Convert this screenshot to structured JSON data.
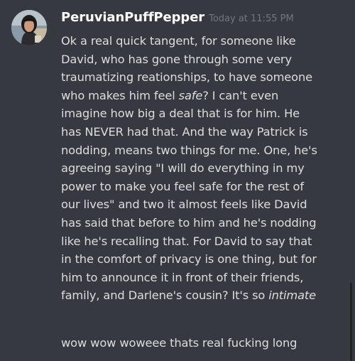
{
  "message": {
    "username": "PeruvianPuffPepper",
    "timestamp": "Today at 11:55 PM",
    "lines": [
      {
        "pre": "Ok a real quick tangent, for someone like",
        "em": "",
        "post": ""
      },
      {
        "pre": "David, who has gone through some very",
        "em": "",
        "post": ""
      },
      {
        "pre": "traumatizing  reationships, to have someone",
        "em": "",
        "post": ""
      },
      {
        "pre": "who makes him feel ",
        "em": "safe",
        "post": "? I can't even"
      },
      {
        "pre": "imagine how big a deal that is for him. He",
        "em": "",
        "post": ""
      },
      {
        "pre": "has NEVER had that. And the way Patrick is",
        "em": "",
        "post": ""
      },
      {
        "pre": "nodding, means two things for me. One, he's",
        "em": "",
        "post": ""
      },
      {
        "pre": "agreeing saying \"I will do everything in my",
        "em": "",
        "post": ""
      },
      {
        "pre": "power to make you feel safe for the rest of",
        "em": "",
        "post": ""
      },
      {
        "pre": "our lives\" and two it almost feels like David",
        "em": "",
        "post": ""
      },
      {
        "pre": "has said that before to him and he's nodding",
        "em": "",
        "post": ""
      },
      {
        "pre": "like he's recalling that. For David to say that",
        "em": "",
        "post": ""
      },
      {
        "pre": "in the comfort of privacy is one thing, but for",
        "em": "",
        "post": ""
      },
      {
        "pre": "him to announce it in front of their friends,",
        "em": "",
        "post": ""
      },
      {
        "pre": "family, and Darlene's cousin? It's so ",
        "em": "intimate",
        "post": ""
      }
    ],
    "followup": "wow wow woweee thats real fucking long"
  }
}
